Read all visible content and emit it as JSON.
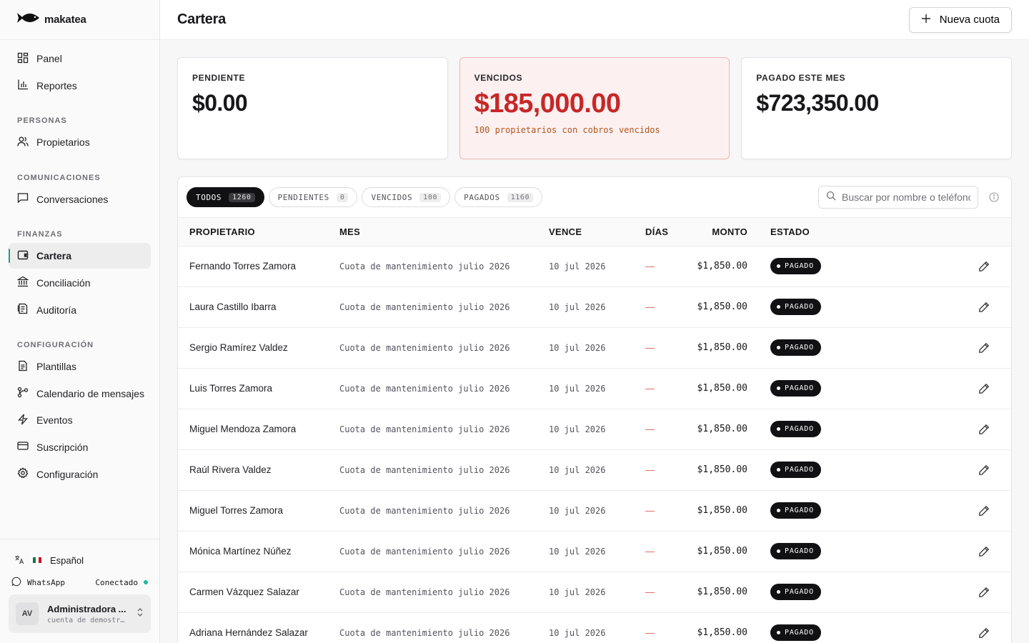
{
  "brand": {
    "name": "makatea"
  },
  "sidebar": {
    "top_items": [
      {
        "label": "Panel",
        "icon": "dashboard-icon"
      },
      {
        "label": "Reportes",
        "icon": "bar-chart-icon"
      }
    ],
    "sections": [
      {
        "title": "PERSONAS",
        "items": [
          {
            "label": "Propietarios",
            "icon": "users-icon"
          }
        ]
      },
      {
        "title": "COMUNICACIONES",
        "items": [
          {
            "label": "Conversaciones",
            "icon": "chat-icon"
          }
        ]
      },
      {
        "title": "FINANZAS",
        "items": [
          {
            "label": "Cartera",
            "icon": "wallet-icon",
            "active": true
          },
          {
            "label": "Conciliación",
            "icon": "bank-icon"
          },
          {
            "label": "Auditoría",
            "icon": "audit-icon"
          }
        ]
      },
      {
        "title": "CONFIGURACIÓN",
        "items": [
          {
            "label": "Plantillas",
            "icon": "document-icon"
          },
          {
            "label": "Calendario de mensajes",
            "icon": "workflow-icon"
          },
          {
            "label": "Eventos",
            "icon": "bolt-icon"
          },
          {
            "label": "Suscripción",
            "icon": "credit-card-icon"
          },
          {
            "label": "Configuración",
            "icon": "gear-icon"
          }
        ]
      }
    ],
    "footer": {
      "language": "Español",
      "whatsapp_label": "WhatsApp",
      "whatsapp_status": "Conectado",
      "user_initials": "AV",
      "user_name": "Administradora ...",
      "user_subtitle": "cuenta de demostr…"
    }
  },
  "header": {
    "title": "Cartera",
    "new_button": "Nueva cuota"
  },
  "summary": [
    {
      "label": "PENDIENTE",
      "value": "$0.00",
      "note": ""
    },
    {
      "label": "VENCIDOS",
      "value": "$185,000.00",
      "note": "100 propietarios con cobros vencidos",
      "color": "#c62828"
    },
    {
      "label": "PAGADO ESTE MES",
      "value": "$723,350.00",
      "note": ""
    }
  ],
  "filters": [
    {
      "label": "TODOS",
      "count": "1260",
      "active": true
    },
    {
      "label": "PENDIENTES",
      "count": "0"
    },
    {
      "label": "VENCIDOS",
      "count": "100"
    },
    {
      "label": "PAGADOS",
      "count": "1160"
    }
  ],
  "search": {
    "placeholder": "Buscar por nombre o teléfono"
  },
  "table": {
    "columns": [
      "PROPIETARIO",
      "MES",
      "VENCE",
      "DÍAS",
      "MONTO",
      "ESTADO"
    ],
    "rows": [
      {
        "owner": "Fernando Torres Zamora",
        "mes": "Cuota de mantenimiento julio 2026",
        "vence": "10 jul 2026",
        "dias": "—",
        "monto": "$1,850.00",
        "estado": "PAGADO"
      },
      {
        "owner": "Laura Castillo Ibarra",
        "mes": "Cuota de mantenimiento julio 2026",
        "vence": "10 jul 2026",
        "dias": "—",
        "monto": "$1,850.00",
        "estado": "PAGADO"
      },
      {
        "owner": "Sergio Ramírez Valdez",
        "mes": "Cuota de mantenimiento julio 2026",
        "vence": "10 jul 2026",
        "dias": "—",
        "monto": "$1,850.00",
        "estado": "PAGADO"
      },
      {
        "owner": "Luis Torres Zamora",
        "mes": "Cuota de mantenimiento julio 2026",
        "vence": "10 jul 2026",
        "dias": "—",
        "monto": "$1,850.00",
        "estado": "PAGADO"
      },
      {
        "owner": "Miguel Mendoza Zamora",
        "mes": "Cuota de mantenimiento julio 2026",
        "vence": "10 jul 2026",
        "dias": "—",
        "monto": "$1,850.00",
        "estado": "PAGADO"
      },
      {
        "owner": "Raúl Rivera Valdez",
        "mes": "Cuota de mantenimiento julio 2026",
        "vence": "10 jul 2026",
        "dias": "—",
        "monto": "$1,850.00",
        "estado": "PAGADO"
      },
      {
        "owner": "Miguel Torres Zamora",
        "mes": "Cuota de mantenimiento julio 2026",
        "vence": "10 jul 2026",
        "dias": "—",
        "monto": "$1,850.00",
        "estado": "PAGADO"
      },
      {
        "owner": "Mónica Martínez Núñez",
        "mes": "Cuota de mantenimiento julio 2026",
        "vence": "10 jul 2026",
        "dias": "—",
        "monto": "$1,850.00",
        "estado": "PAGADO"
      },
      {
        "owner": "Carmen Vázquez Salazar",
        "mes": "Cuota de mantenimiento julio 2026",
        "vence": "10 jul 2026",
        "dias": "—",
        "monto": "$1,850.00",
        "estado": "PAGADO"
      },
      {
        "owner": "Adriana Hernández Salazar",
        "mes": "Cuota de mantenimiento julio 2026",
        "vence": "10 jul 2026",
        "dias": "—",
        "monto": "$1,850.00",
        "estado": "PAGADO"
      }
    ]
  }
}
